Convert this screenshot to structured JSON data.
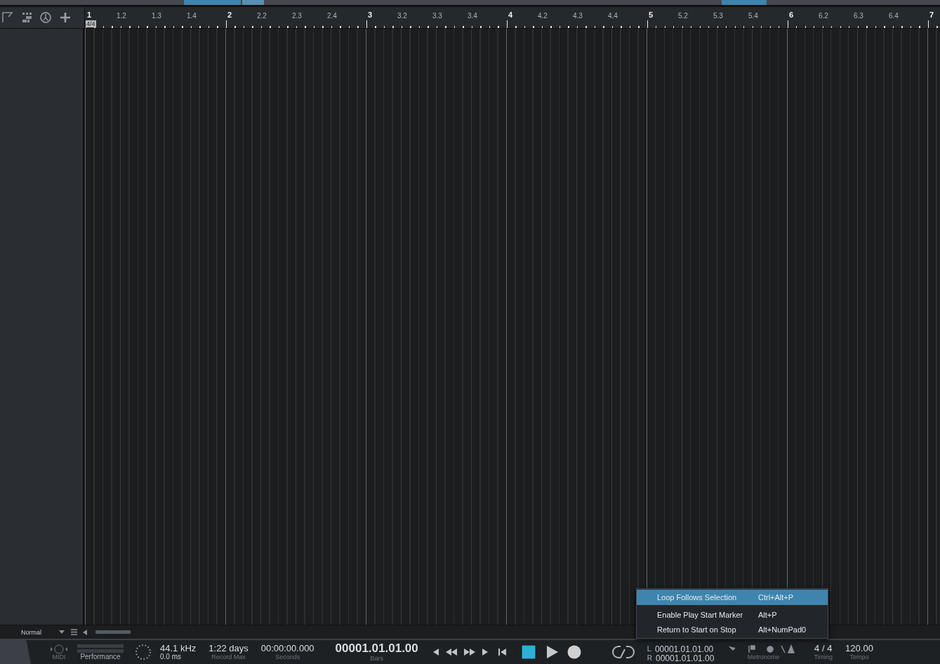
{
  "ruler": {
    "time_signature": "4/4",
    "labels": [
      {
        "text": "1",
        "kind": "bar"
      },
      {
        "text": "1.2",
        "kind": "beat"
      },
      {
        "text": "1.3",
        "kind": "beat"
      },
      {
        "text": "1.4",
        "kind": "beat"
      },
      {
        "text": "2",
        "kind": "bar"
      },
      {
        "text": "2.2",
        "kind": "beat"
      },
      {
        "text": "2.3",
        "kind": "beat"
      },
      {
        "text": "2.4",
        "kind": "beat"
      },
      {
        "text": "3",
        "kind": "bar"
      },
      {
        "text": "3.2",
        "kind": "beat"
      },
      {
        "text": "3.3",
        "kind": "beat"
      },
      {
        "text": "3.4",
        "kind": "beat"
      },
      {
        "text": "4",
        "kind": "bar"
      },
      {
        "text": "4.2",
        "kind": "beat"
      },
      {
        "text": "4.3",
        "kind": "beat"
      },
      {
        "text": "4.4",
        "kind": "beat"
      },
      {
        "text": "5",
        "kind": "bar"
      },
      {
        "text": "5.2",
        "kind": "beat"
      },
      {
        "text": "5.3",
        "kind": "beat"
      },
      {
        "text": "5.4",
        "kind": "beat"
      },
      {
        "text": "6",
        "kind": "bar"
      },
      {
        "text": "6.2",
        "kind": "beat"
      },
      {
        "text": "6.3",
        "kind": "beat"
      },
      {
        "text": "6.4",
        "kind": "beat"
      },
      {
        "text": "7",
        "kind": "bar"
      }
    ]
  },
  "zoom": {
    "value": "Normal"
  },
  "transport": {
    "midi_label": "MIDI",
    "performance_label": "Performance",
    "sample_rate": "44.1 kHz",
    "latency": "0.0 ms",
    "record_max": "1:22 days",
    "record_max_label": "Record Max",
    "seconds": "00:00:00.000",
    "seconds_label": "Seconds",
    "bars": "00001.01.01.00",
    "bars_label": "Bars",
    "left_locator_tag": "L",
    "left_locator": "00001.01.01.00",
    "right_locator_tag": "R",
    "right_locator": "00001.01.01.00",
    "metronome_label": "Metronome",
    "timing": "4 / 4",
    "timing_label": "Timing",
    "tempo": "120.00",
    "tempo_label": "Tempo",
    "stopped": true
  },
  "context_menu": {
    "items": [
      {
        "label": "Loop Follows Selection",
        "shortcut": "Ctrl+Alt+P",
        "selected": true
      },
      {
        "label": "Enable Play Start Marker",
        "shortcut": "Alt+P",
        "selected": false
      },
      {
        "label": "Return to Start on Stop",
        "shortcut": "Alt+NumPad0",
        "selected": false
      }
    ]
  }
}
